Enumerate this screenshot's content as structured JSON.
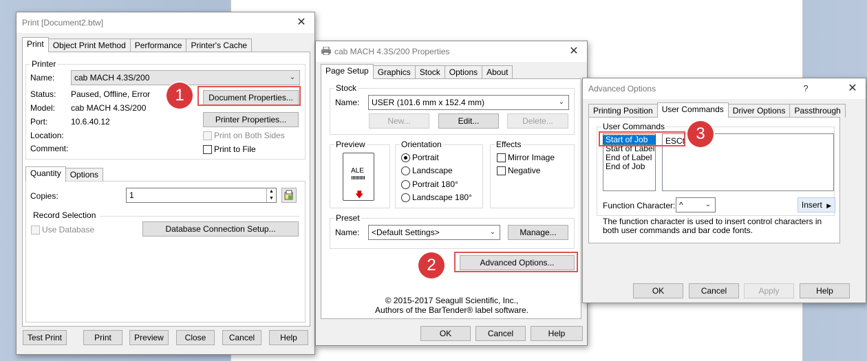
{
  "print_dialog": {
    "title": "Print [Document2.btw]",
    "tabs": [
      "Print",
      "Object Print Method",
      "Performance",
      "Printer's Cache"
    ],
    "printer_group": "Printer",
    "name_label": "Name:",
    "name_value": "cab MACH 4.3S/200",
    "status_label": "Status:",
    "status_value": "Paused, Offline, Error",
    "model_label": "Model:",
    "model_value": "cab MACH 4.3S/200",
    "port_label": "Port:",
    "port_value": "10.6.40.12",
    "location_label": "Location:",
    "comment_label": "Comment:",
    "doc_props_btn": "Document Properties...",
    "printer_props_btn": "Printer Properties...",
    "print_both_sides": "Print on Both Sides",
    "print_to_file": "Print to File",
    "sub_tabs": [
      "Quantity",
      "Options"
    ],
    "copies_label": "Copies:",
    "copies_value": "1",
    "record_selection": "Record Selection",
    "use_database": "Use Database",
    "db_setup_btn": "Database Connection Setup...",
    "footer": {
      "test_print": "Test Print",
      "print": "Print",
      "preview": "Preview",
      "close": "Close",
      "cancel": "Cancel",
      "help": "Help"
    }
  },
  "props_dialog": {
    "title": "cab MACH 4.3S/200 Properties",
    "tabs": [
      "Page Setup",
      "Graphics",
      "Stock",
      "Options",
      "About"
    ],
    "stock_group": "Stock",
    "name_label": "Name:",
    "stock_name": "USER (101.6 mm x 152.4 mm)",
    "new_btn": "New...",
    "edit_btn": "Edit...",
    "delete_btn": "Delete...",
    "preview_group": "Preview",
    "preview_label": "ALE",
    "orientation_group": "Orientation",
    "orientations": [
      "Portrait",
      "Landscape",
      "Portrait 180°",
      "Landscape 180°"
    ],
    "effects_group": "Effects",
    "mirror_image": "Mirror Image",
    "negative": "Negative",
    "preset_group": "Preset",
    "preset_name_label": "Name:",
    "preset_value": "<Default Settings>",
    "manage_btn": "Manage...",
    "advanced_btn": "Advanced Options...",
    "copyright1": "© 2015-2017 Seagull Scientific, Inc.,",
    "copyright2": "Authors of the BarTender® label software.",
    "footer": {
      "ok": "OK",
      "cancel": "Cancel",
      "help": "Help"
    }
  },
  "advanced_dialog": {
    "title": "Advanced Options",
    "help_glyph": "?",
    "tabs": [
      "Printing Position",
      "User Commands",
      "Driver Options",
      "Passthrough"
    ],
    "user_commands_group": "User Commands",
    "commands": [
      "Start of Job",
      "Start of Label",
      "End of Label",
      "End of Job"
    ],
    "command_value": "ESCt",
    "function_char_label": "Function Character:",
    "function_char_value": "^",
    "insert_btn": "Insert",
    "description": "The function character is used to insert control characters in both user commands and bar code fonts.",
    "footer": {
      "ok": "OK",
      "cancel": "Cancel",
      "apply": "Apply",
      "help": "Help"
    }
  },
  "callouts": [
    "1",
    "2",
    "3"
  ],
  "colors": {
    "callout": "#d9383a",
    "highlight": "#e05252",
    "selection": "#0078d7"
  }
}
